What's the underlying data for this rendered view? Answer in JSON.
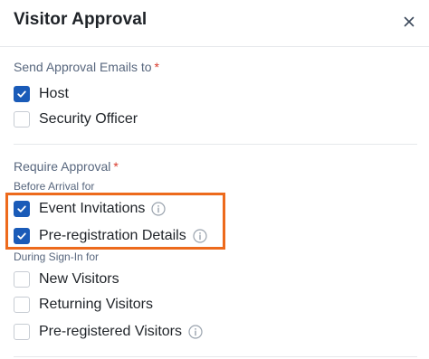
{
  "dialog": {
    "title": "Visitor Approval",
    "close_icon": "close-icon"
  },
  "send_emails": {
    "label": "Send Approval Emails to",
    "required_mark": "*",
    "options": [
      {
        "label": "Host",
        "checked": true
      },
      {
        "label": "Security Officer",
        "checked": false
      }
    ]
  },
  "require_approval": {
    "label": "Require Approval",
    "required_mark": "*",
    "before_arrival": {
      "label": "Before Arrival for",
      "options": [
        {
          "label": "Event Invitations",
          "checked": true,
          "info_icon": "info-icon"
        },
        {
          "label": "Pre-registration Details",
          "checked": true,
          "info_icon": "info-icon"
        }
      ]
    },
    "during_sign_in": {
      "label": "During Sign-In for",
      "options": [
        {
          "label": "New Visitors",
          "checked": false
        },
        {
          "label": "Returning Visitors",
          "checked": false
        },
        {
          "label": "Pre-registered Visitors",
          "checked": false,
          "info_icon": "info-icon"
        }
      ]
    }
  },
  "colors": {
    "checkbox_checked": "#1a5bb8",
    "required_mark": "#d93a2b",
    "highlight_border": "#ed6a1c",
    "section_label": "#58677e"
  }
}
